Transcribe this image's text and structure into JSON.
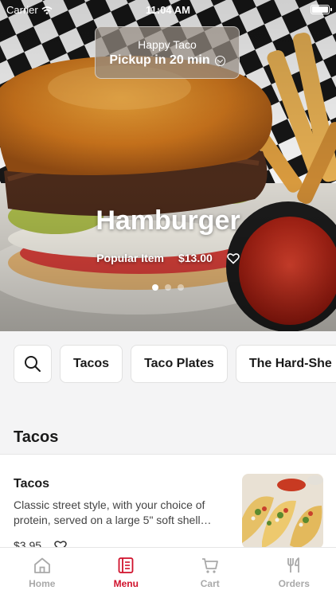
{
  "status_bar": {
    "carrier": "Carrier",
    "time": "11:04 AM"
  },
  "pickup": {
    "store_name": "Happy Taco",
    "pickup_text": "Pickup in 20 min"
  },
  "featured": {
    "title": "Hamburger",
    "badge": "Popular Item",
    "price": "$13.00",
    "slides": 3,
    "active_slide": 1
  },
  "categories": [
    "Tacos",
    "Taco Plates",
    "The Hard-She"
  ],
  "section": {
    "title": "Tacos"
  },
  "menu_item": {
    "name": "Tacos",
    "description": "Classic street style, with your choice of protein, served on a large 5\" soft shell…",
    "price": "$3.95"
  },
  "tabs": [
    {
      "label": "Home",
      "icon": "home-icon",
      "active": false
    },
    {
      "label": "Menu",
      "icon": "menu-icon",
      "active": true
    },
    {
      "label": "Cart",
      "icon": "cart-icon",
      "active": false
    },
    {
      "label": "Orders",
      "icon": "utensils-icon",
      "active": false
    }
  ],
  "colors": {
    "accent": "#d0112b",
    "inactive_tab": "#a9a9a9"
  }
}
